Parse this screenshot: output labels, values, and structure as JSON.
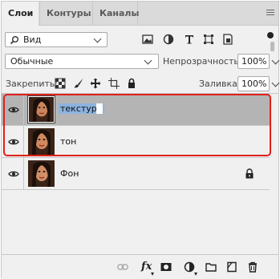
{
  "tabs": [
    {
      "label": "Слои"
    },
    {
      "label": "Контуры"
    },
    {
      "label": "Каналы"
    }
  ],
  "filter": {
    "kind_label": "Вид"
  },
  "blend": {
    "mode_label": "Обычные"
  },
  "opacity": {
    "label": "Непрозрачность:",
    "value": "100%"
  },
  "lock": {
    "label": "Закрепить:"
  },
  "fill": {
    "label": "Заливка:",
    "value": "100%"
  },
  "layers": [
    {
      "name": "текстура"
    },
    {
      "name": "тон"
    },
    {
      "name": "Фон"
    }
  ],
  "footer": {
    "fx_label": "fx"
  },
  "colors": {
    "highlight": "#e0201b",
    "selected_row": "#b4b4b4",
    "name_selection": "#8cb3e0"
  },
  "icons": [
    "eye-icon",
    "padlock-icon",
    "link-icon",
    "fx-icon",
    "mask-icon",
    "adjustment-icon",
    "folder-icon",
    "new-layer-icon",
    "trash-icon"
  ]
}
